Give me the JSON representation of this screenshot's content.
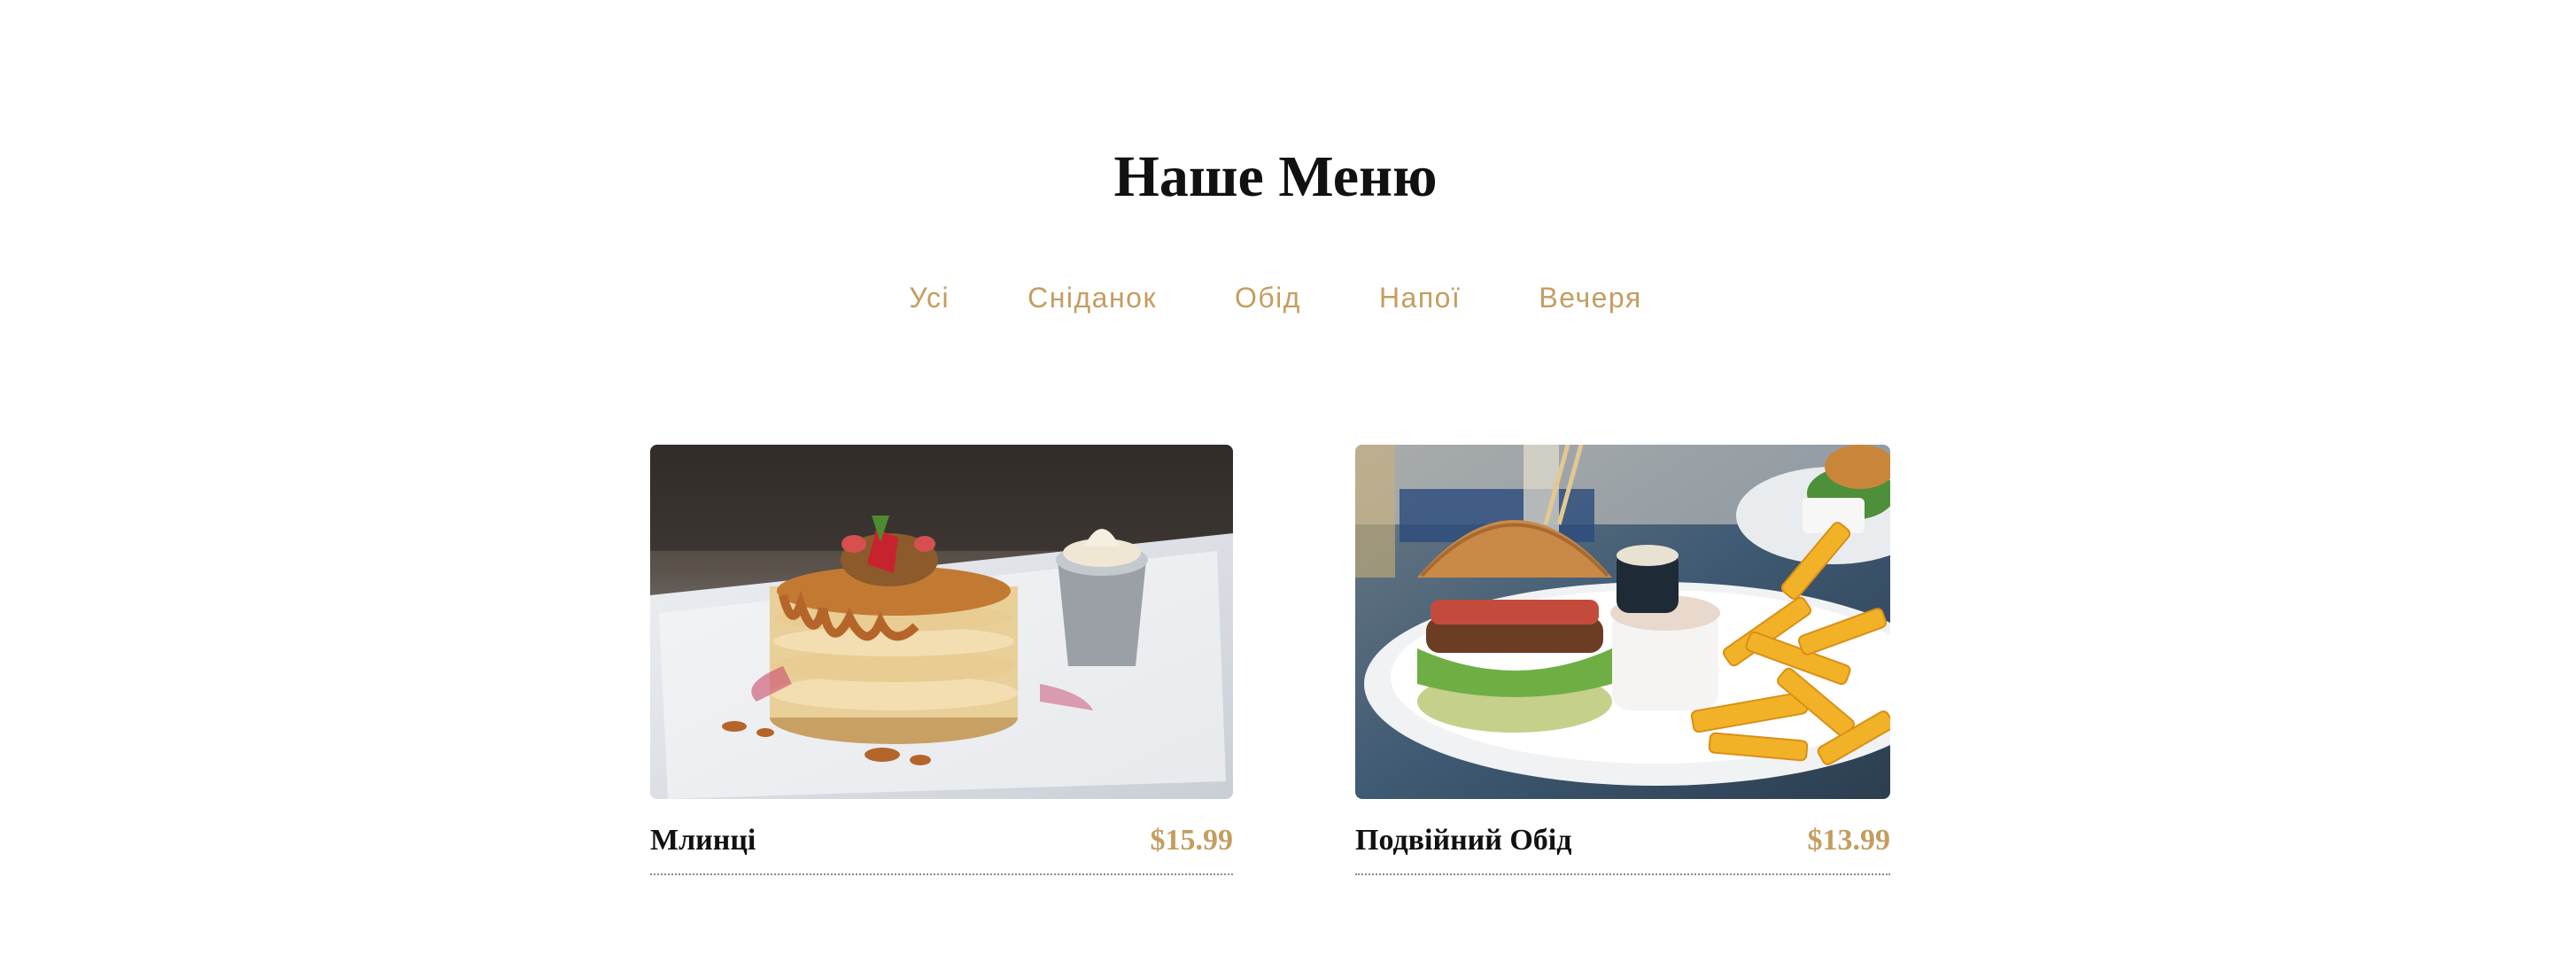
{
  "page": {
    "title": "Наше Меню"
  },
  "filters": [
    {
      "label": "Усі"
    },
    {
      "label": "Сніданок"
    },
    {
      "label": "Обід"
    },
    {
      "label": "Напої"
    },
    {
      "label": "Вечеря"
    }
  ],
  "menu": {
    "items": [
      {
        "name": "Млинці",
        "price": "$15.99",
        "image": "pancakes-photo"
      },
      {
        "name": "Подвійний Обід",
        "price": "$13.99",
        "image": "burger-fries-photo"
      }
    ]
  },
  "colors": {
    "accent": "#c59d5f",
    "text": "#111111",
    "divider": "#8a8a9a"
  }
}
